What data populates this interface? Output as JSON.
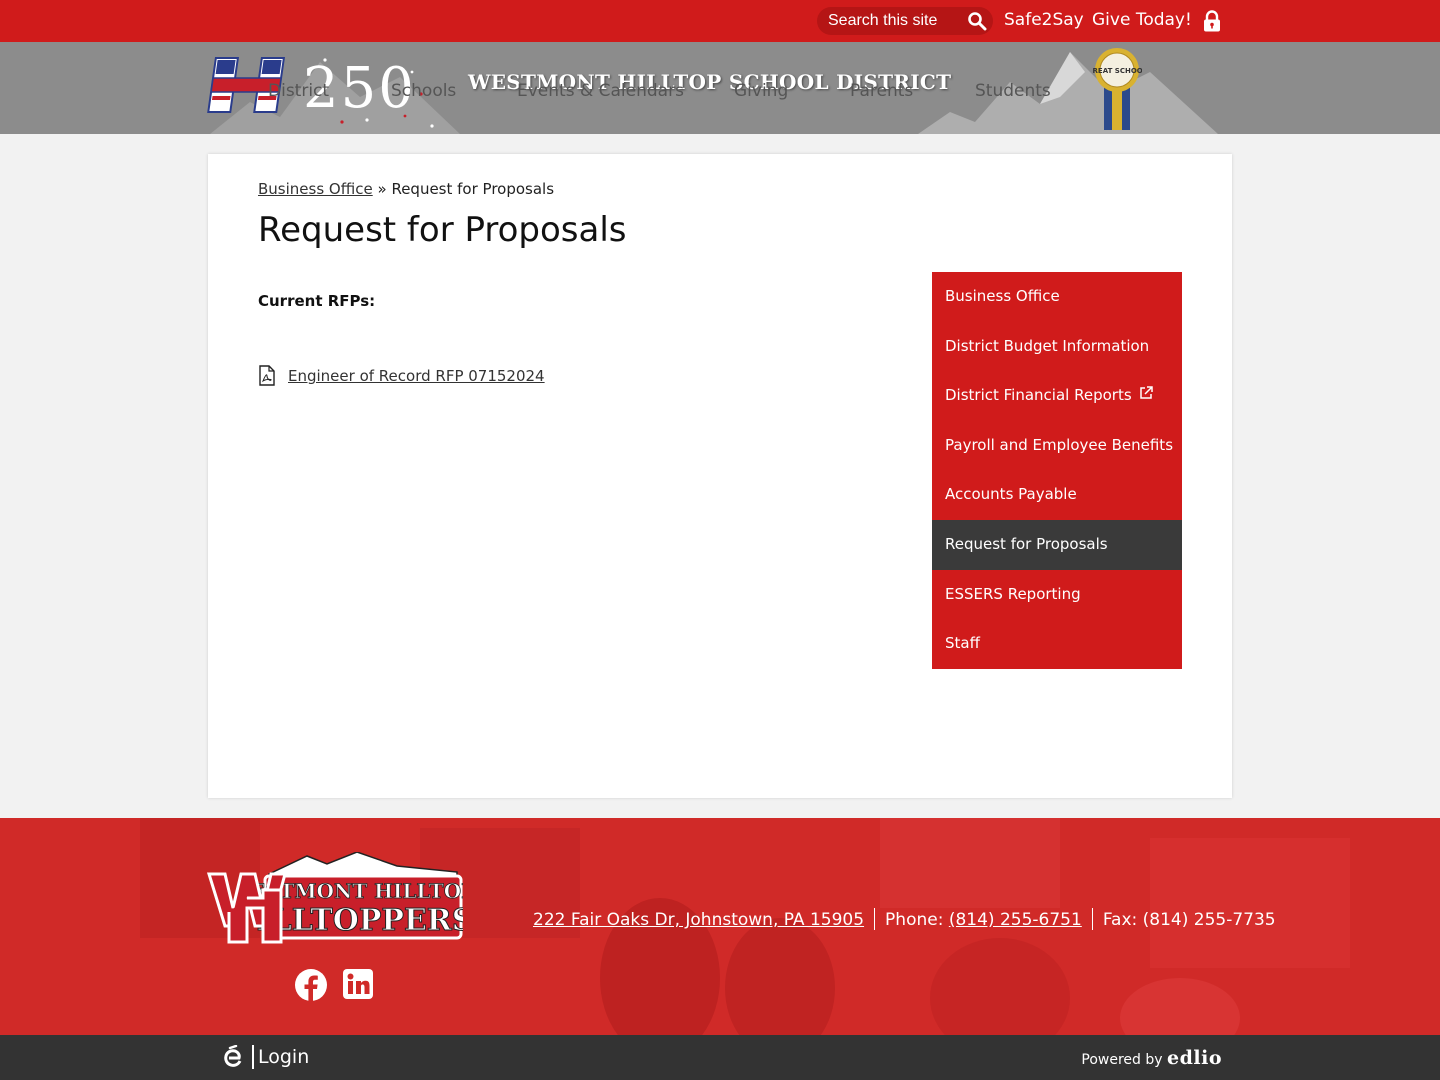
{
  "topbar": {
    "search_placeholder": "Search this site",
    "links": [
      "Safe2Say",
      "Give Today!"
    ]
  },
  "header": {
    "logo_text": "250",
    "district_title": "WESTMONT HILLTOP SCHOOL DISTRICT",
    "nav": [
      "District",
      "Schools",
      "Events & Calendars",
      "Giving",
      "Parents",
      "Students"
    ],
    "badge_text": "GREAT SCHOOL"
  },
  "breadcrumb": {
    "parent": "Business Office",
    "separator": "»",
    "current": "Request for Proposals"
  },
  "page_title": "Request for Proposals",
  "content": {
    "section_label": "Current RFPs:",
    "document_link": "Engineer of Record RFP 07152024"
  },
  "sidenav": {
    "items": [
      {
        "label": "Business Office"
      },
      {
        "label": "District Budget Information"
      },
      {
        "label": "District Financial Reports"
      },
      {
        "label": "Payroll and Employee Benefits"
      },
      {
        "label": "Accounts Payable"
      },
      {
        "label": "Request for Proposals"
      },
      {
        "label": "ESSERS Reporting"
      },
      {
        "label": "Staff"
      }
    ]
  },
  "footer": {
    "logo_line1": "ESTMONT HILLTOP",
    "logo_line2": "ILLTOPPERS",
    "address": "222 Fair Oaks Dr, Johnstown, PA 15905",
    "phone_label": "Phone:",
    "phone": "(814) 255-6751",
    "fax": "Fax: (814) 255-7735"
  },
  "bottombar": {
    "login": "Login",
    "powered_by": "Powered by",
    "brand": "edlio"
  },
  "colors": {
    "primary_red": "#d01b1b",
    "header_gray": "#8c8c8c",
    "active_nav": "#3a3a3a",
    "bottom_bar": "#333333"
  }
}
